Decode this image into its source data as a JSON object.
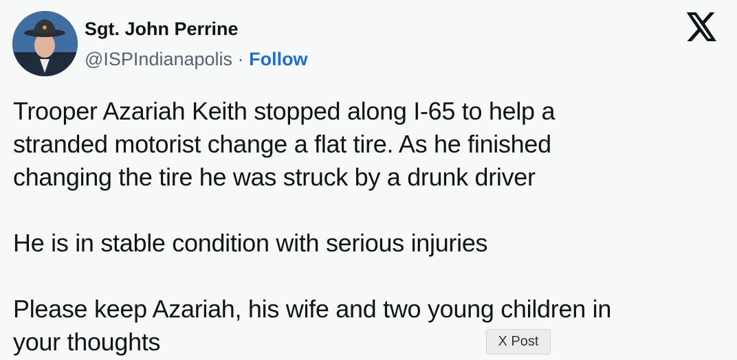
{
  "author": {
    "name": "Sgt. John Perrine",
    "handle": "@ISPIndianapolis",
    "separator": "·",
    "follow_label": "Follow"
  },
  "icons": {
    "avatar": "profile-photo-avatar",
    "platform": "x-logo-icon"
  },
  "tweet": {
    "lines": [
      "Trooper Azariah Keith stopped along I-65 to help a",
      "stranded motorist change a flat tire. As he finished",
      "changing the tire he was struck by a drunk driver",
      "",
      "He is in stable condition with serious injuries",
      "",
      "Please keep Azariah, his wife and two young children in",
      "your thoughts"
    ]
  },
  "tooltip": {
    "label": "X Post"
  },
  "colors": {
    "background": "#f7f9f9",
    "text": "#0f1419",
    "secondary_text": "#536471",
    "follow": "#1d6fd6"
  }
}
